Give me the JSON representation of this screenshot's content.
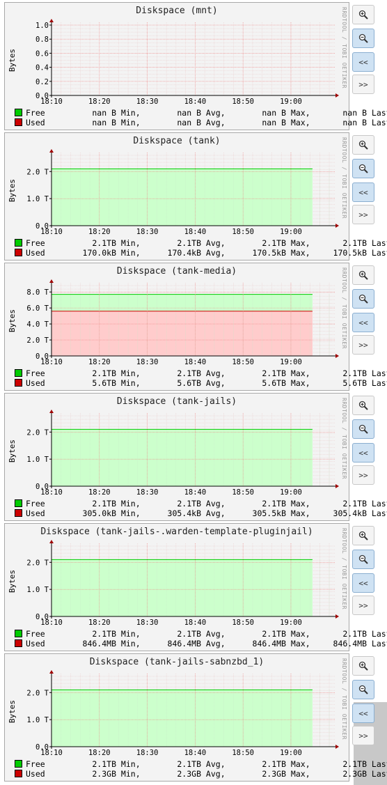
{
  "ylabel": "Bytes",
  "watermark": "RRDTOOL / TOBI OETIKER",
  "buttons": {
    "zoom_in_icon": "zoom-in-icon",
    "zoom_out_icon": "zoom-out-icon",
    "back_label": "<<",
    "forward_label": ">>"
  },
  "colors": {
    "free": "#00cc00",
    "used": "#cc0000",
    "free_fill": "#ccffcc",
    "used_fill": "#ffcccc"
  },
  "graphs": [
    {
      "title": "Diskspace (mnt)",
      "legend": [
        {
          "name": "Free",
          "min": "nan B",
          "avg": "nan B",
          "max": "nan B",
          "last": "nan B"
        },
        {
          "name": "Used",
          "min": "nan B",
          "avg": "nan B",
          "max": "nan B",
          "last": "nan B"
        }
      ]
    },
    {
      "title": "Diskspace (tank)",
      "legend": [
        {
          "name": "Free",
          "min": "2.1TB",
          "avg": "2.1TB",
          "max": "2.1TB",
          "last": "2.1TB"
        },
        {
          "name": "Used",
          "min": "170.0kB",
          "avg": "170.4kB",
          "max": "170.5kB",
          "last": "170.5kB"
        }
      ]
    },
    {
      "title": "Diskspace (tank-media)",
      "legend": [
        {
          "name": "Free",
          "min": "2.1TB",
          "avg": "2.1TB",
          "max": "2.1TB",
          "last": "2.1TB"
        },
        {
          "name": "Used",
          "min": "5.6TB",
          "avg": "5.6TB",
          "max": "5.6TB",
          "last": "5.6TB"
        }
      ]
    },
    {
      "title": "Diskspace (tank-jails)",
      "legend": [
        {
          "name": "Free",
          "min": "2.1TB",
          "avg": "2.1TB",
          "max": "2.1TB",
          "last": "2.1TB"
        },
        {
          "name": "Used",
          "min": "305.0kB",
          "avg": "305.4kB",
          "max": "305.5kB",
          "last": "305.4kB"
        }
      ]
    },
    {
      "title": "Diskspace (tank-jails-.warden-template-pluginjail)",
      "legend": [
        {
          "name": "Free",
          "min": "2.1TB",
          "avg": "2.1TB",
          "max": "2.1TB",
          "last": "2.1TB"
        },
        {
          "name": "Used",
          "min": "846.4MB",
          "avg": "846.4MB",
          "max": "846.4MB",
          "last": "846.4MB"
        }
      ]
    },
    {
      "title": "Diskspace (tank-jails-sabnzbd_1)",
      "legend": [
        {
          "name": "Free",
          "min": "2.1TB",
          "avg": "2.1TB",
          "max": "2.1TB",
          "last": "2.1TB"
        },
        {
          "name": "Used",
          "min": "2.3GB",
          "avg": "2.3GB",
          "max": "2.3GB",
          "last": "2.3GB"
        }
      ]
    }
  ],
  "chart_data": [
    {
      "type": "area",
      "title": "Diskspace (mnt)",
      "xlabel": "",
      "ylabel": "Bytes",
      "x_ticks": [
        "18:10",
        "18:20",
        "18:30",
        "18:40",
        "18:50",
        "19:00"
      ],
      "y_ticks": [
        "0.0",
        "0.2",
        "0.4",
        "0.6",
        "0.8",
        "1.0"
      ],
      "ylim": [
        0,
        1.0
      ],
      "series": [
        {
          "name": "Free",
          "values": []
        },
        {
          "name": "Used",
          "values": []
        }
      ],
      "grid": true,
      "legend": "bottom"
    },
    {
      "type": "area",
      "title": "Diskspace (tank)",
      "xlabel": "",
      "ylabel": "Bytes",
      "x_ticks": [
        "18:10",
        "18:20",
        "18:30",
        "18:40",
        "18:50",
        "19:00"
      ],
      "y_ticks": [
        "0.0",
        "1.0 T",
        "2.0 T"
      ],
      "ylim": [
        0,
        2.6
      ],
      "series": [
        {
          "name": "Free",
          "values": [
            2.1,
            2.1
          ]
        },
        {
          "name": "Used",
          "values": [
            1.7e-07,
            1.7e-07
          ]
        }
      ],
      "grid": true,
      "legend": "bottom"
    },
    {
      "type": "area",
      "title": "Diskspace (tank-media)",
      "xlabel": "",
      "ylabel": "Bytes",
      "x_ticks": [
        "18:10",
        "18:20",
        "18:30",
        "18:40",
        "18:50",
        "19:00"
      ],
      "y_ticks": [
        "0.0",
        "2.0 T",
        "4.0 T",
        "6.0 T",
        "8.0 T"
      ],
      "ylim": [
        0,
        8.8
      ],
      "series": [
        {
          "name": "Free",
          "values": [
            2.1,
            2.1
          ]
        },
        {
          "name": "Used",
          "values": [
            5.6,
            5.6
          ]
        }
      ],
      "grid": true,
      "legend": "bottom"
    },
    {
      "type": "area",
      "title": "Diskspace (tank-jails)",
      "xlabel": "",
      "ylabel": "Bytes",
      "x_ticks": [
        "18:10",
        "18:20",
        "18:30",
        "18:40",
        "18:50",
        "19:00"
      ],
      "y_ticks": [
        "0.0",
        "1.0 T",
        "2.0 T"
      ],
      "ylim": [
        0,
        2.6
      ],
      "series": [
        {
          "name": "Free",
          "values": [
            2.1,
            2.1
          ]
        },
        {
          "name": "Used",
          "values": [
            3e-07,
            3e-07
          ]
        }
      ],
      "grid": true,
      "legend": "bottom"
    },
    {
      "type": "area",
      "title": "Diskspace (tank-jails-.warden-template-pluginjail)",
      "xlabel": "",
      "ylabel": "Bytes",
      "x_ticks": [
        "18:10",
        "18:20",
        "18:30",
        "18:40",
        "18:50",
        "19:00"
      ],
      "y_ticks": [
        "0.0",
        "1.0 T",
        "2.0 T"
      ],
      "ylim": [
        0,
        2.6
      ],
      "series": [
        {
          "name": "Free",
          "values": [
            2.1,
            2.1
          ]
        },
        {
          "name": "Used",
          "values": [
            0.0008,
            0.0008
          ]
        }
      ],
      "grid": true,
      "legend": "bottom"
    },
    {
      "type": "area",
      "title": "Diskspace (tank-jails-sabnzbd_1)",
      "xlabel": "",
      "ylabel": "Bytes",
      "x_ticks": [
        "18:10",
        "18:20",
        "18:30",
        "18:40",
        "18:50",
        "19:00"
      ],
      "y_ticks": [
        "0.0",
        "1.0 T",
        "2.0 T"
      ],
      "ylim": [
        0,
        2.6
      ],
      "series": [
        {
          "name": "Free",
          "values": [
            2.1,
            2.1
          ]
        },
        {
          "name": "Used",
          "values": [
            0.0023,
            0.0023
          ]
        }
      ],
      "grid": true,
      "legend": "bottom"
    }
  ]
}
